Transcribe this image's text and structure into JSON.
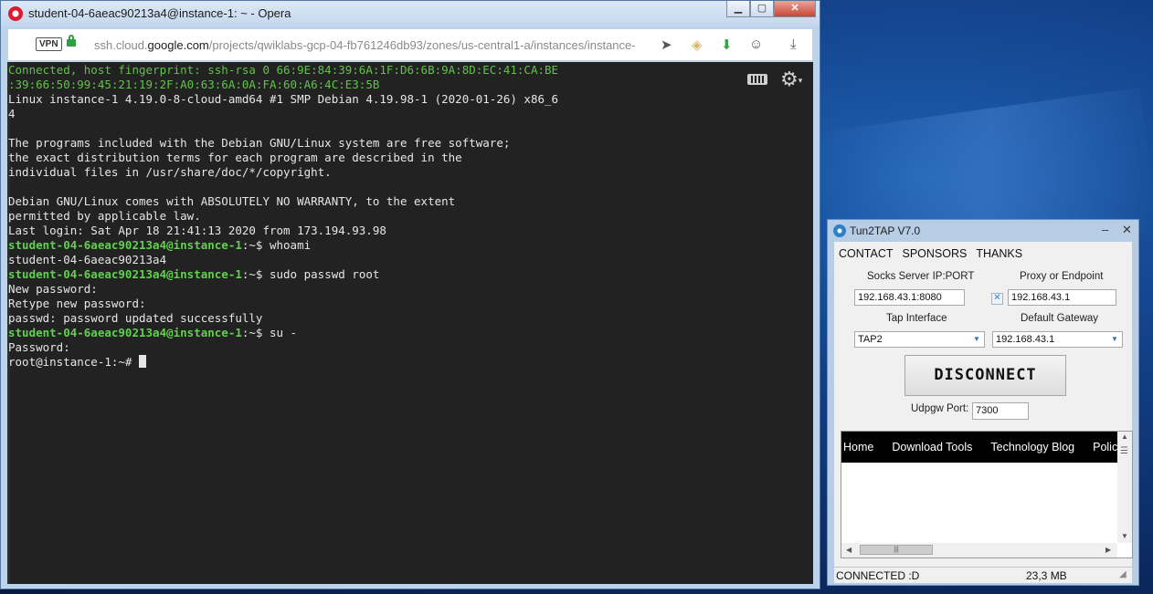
{
  "browser": {
    "title": "student-04-6aeac90213a4@instance-1: ~ - Opera",
    "vpn_label": "VPN",
    "url_prefix": "ssh.cloud.",
    "url_host": "google.com",
    "url_path": "/projects/qwiklabs-gcp-04-fb761246db93/zones/us-central1-a/instances/instance-"
  },
  "terminal": {
    "fingerprint_1": "Connected, host fingerprint: ssh-rsa 0 66:9E:84:39:6A:1F:D6:6B:9A:8D:EC:41:CA:BE",
    "fingerprint_2": ":39:66:50:99:45:21:19:2F:A0:63:6A:0A:FA:60:A6:4C:E3:5B",
    "uname_1": "Linux instance-1 4.19.0-8-cloud-amd64 #1 SMP Debian 4.19.98-1 (2020-01-26) x86_6",
    "uname_2": "4",
    "motd_1": "The programs included with the Debian GNU/Linux system are free software;",
    "motd_2": "the exact distribution terms for each program are described in the",
    "motd_3": "individual files in /usr/share/doc/*/copyright.",
    "motd_4": "Debian GNU/Linux comes with ABSOLUTELY NO WARRANTY, to the extent",
    "motd_5": "permitted by applicable law.",
    "last_login": "Last login: Sat Apr 18 21:41:13 2020 from 173.194.93.98",
    "user_prompt": "student-04-6aeac90213a4@instance-1",
    "prompt_suffix": ":~$ ",
    "cmd_1": "whoami",
    "out_1": "student-04-6aeac90213a4",
    "cmd_2": "sudo passwd root",
    "out_2a": "New password:",
    "out_2b": "Retype new password:",
    "out_2c": "passwd: password updated successfully",
    "cmd_3": "su -",
    "out_3": "Password:",
    "root_prompt": "root@instance-1:~# "
  },
  "tun2tap": {
    "title": "Tun2TAP V7.0",
    "menu": [
      "CONTACT",
      "SPONSORS",
      "THANKS"
    ],
    "socks_label": "Socks Server IP:PORT",
    "socks_value": "192.168.43.1:8080",
    "proxy_label": "Proxy or Endpoint",
    "proxy_value": "192.168.43.1",
    "tap_label": "Tap Interface",
    "tap_value": "TAP2",
    "gateway_label": "Default Gateway",
    "gateway_value": "192.168.43.1",
    "disconnect_label": "DISCONNECT",
    "udpgw_label": "Udpgw Port:",
    "udpgw_value": "7300",
    "web_nav": [
      "Home",
      "Download Tools",
      "Technology Blog",
      "Policy"
    ],
    "status_left": "CONNECTED :D",
    "status_right": "23,3 MB"
  }
}
